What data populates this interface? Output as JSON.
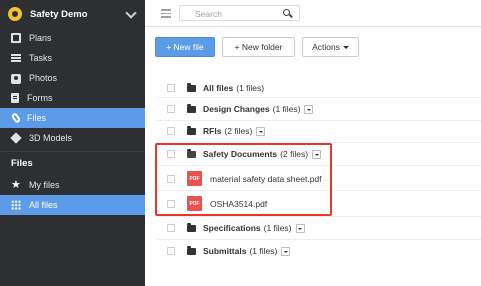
{
  "project": {
    "name": "Safety Demo"
  },
  "sidebar": {
    "items": [
      {
        "label": "Plans",
        "icon": "plans-icon"
      },
      {
        "label": "Tasks",
        "icon": "tasks-icon"
      },
      {
        "label": "Photos",
        "icon": "photos-icon"
      },
      {
        "label": "Forms",
        "icon": "forms-icon"
      },
      {
        "label": "Files",
        "icon": "files-icon",
        "active": true
      },
      {
        "label": "3D Models",
        "icon": "3d-models-icon"
      }
    ],
    "section_title": "Files",
    "sub_items": [
      {
        "label": "My files",
        "icon": "star-icon"
      },
      {
        "label": "All files",
        "icon": "grid-icon",
        "active": true
      }
    ]
  },
  "search": {
    "placeholder": "Search"
  },
  "toolbar": {
    "new_file_label": "+ New file",
    "new_folder_label": "+ New folder",
    "actions_label": "Actions"
  },
  "list": {
    "folders": [
      {
        "name": "All files",
        "count": "(1 files)"
      },
      {
        "name": "Design Changes",
        "count": "(1 files)"
      },
      {
        "name": "RFIs",
        "count": "(2 files)"
      },
      {
        "name": "Safety Documents",
        "count": "(2 files)"
      },
      {
        "name": "Specifications",
        "count": "(1 files)"
      },
      {
        "name": "Submittals",
        "count": "(1 files)"
      }
    ],
    "files": [
      {
        "name": "material safety data sheet.pdf",
        "type_badge": "PDF"
      },
      {
        "name": "OSHA3514.pdf",
        "type_badge": "PDF"
      }
    ]
  },
  "colors": {
    "accent": "#5b9be8",
    "sidebar_bg": "#2d2f33",
    "highlight": "#e8372a",
    "pdf_badge": "#e9534f"
  }
}
